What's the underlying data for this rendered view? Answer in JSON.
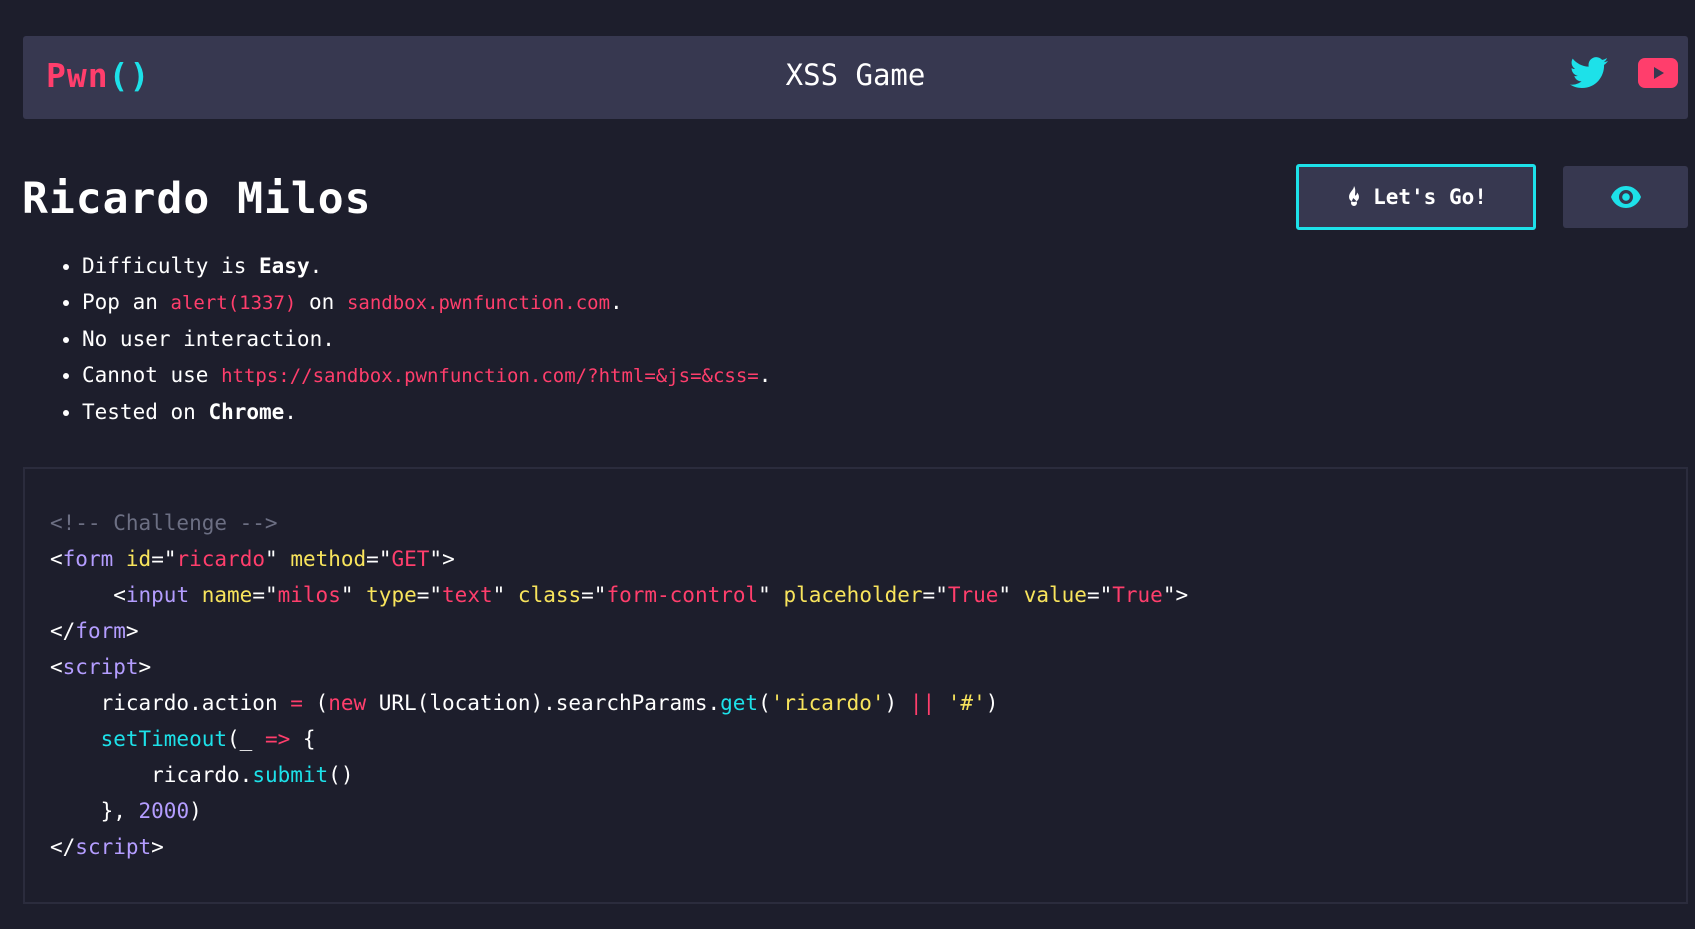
{
  "nav": {
    "brand_main": "Pwn",
    "brand_paren": "()",
    "title": "XSS Game"
  },
  "challenge": {
    "title": "Ricardo Milos",
    "go_label": "Let's Go!"
  },
  "rules": {
    "r1_a": "Difficulty is ",
    "r1_b": "Easy",
    "r1_c": ".",
    "r2_a": "Pop an ",
    "r2_b": "alert(1337)",
    "r2_c": " on ",
    "r2_d": "sandbox.pwnfunction.com",
    "r2_e": ".",
    "r3": "No user interaction.",
    "r4_a": "Cannot use ",
    "r4_b": "https://sandbox.pwnfunction.com/?html=&js=&css=",
    "r4_c": ".",
    "r5_a": "Tested on ",
    "r5_b": "Chrome",
    "r5_c": "."
  },
  "code": {
    "comment": "<!-- Challenge -->",
    "lt": "<",
    "gt": ">",
    "lt_slash": "</",
    "eq_q": "=\"",
    "q": "\"",
    "tag_form": "form",
    "tag_input": "input",
    "tag_script": "script",
    "attr_id": "id",
    "val_id": "ricardo",
    "attr_method": "method",
    "val_method": "GET",
    "attr_name": "name",
    "val_name": "milos",
    "attr_type": "type",
    "val_type": "text",
    "attr_class": "class",
    "val_class": "form-control",
    "attr_placeholder": "placeholder",
    "val_placeholder": "True",
    "attr_value": "value",
    "val_value": "True",
    "l6_a": "ricardo.action ",
    "l6_eq": "=",
    "l6_b": " (",
    "l6_new": "new",
    "l6_c": " URL(location).searchParams.",
    "l6_get": "get",
    "l6_d": "(",
    "l6_str1": "'ricardo'",
    "l6_e": ") ",
    "l6_or": "||",
    "l6_f": " ",
    "l6_str2": "'#'",
    "l6_g": ")",
    "l7_fn": "setTimeout",
    "l7_a": "(_ ",
    "l7_arrow": "=>",
    "l7_b": " {",
    "l8_a": "ricardo.",
    "l8_fn": "submit",
    "l8_b": "()",
    "l9_a": "}, ",
    "l9_num": "2000",
    "l9_b": ")"
  },
  "colors": {
    "background": "#1d1e2c",
    "panel": "#373850",
    "accent_pink": "#ff3e6c",
    "accent_cyan": "#1de1e9",
    "keyword_yellow": "#f8e45c",
    "tag_purple": "#b49dff"
  },
  "icons": {
    "twitter": "twitter-icon",
    "youtube": "youtube-icon",
    "flame": "flame-icon",
    "eye": "eye-icon"
  }
}
